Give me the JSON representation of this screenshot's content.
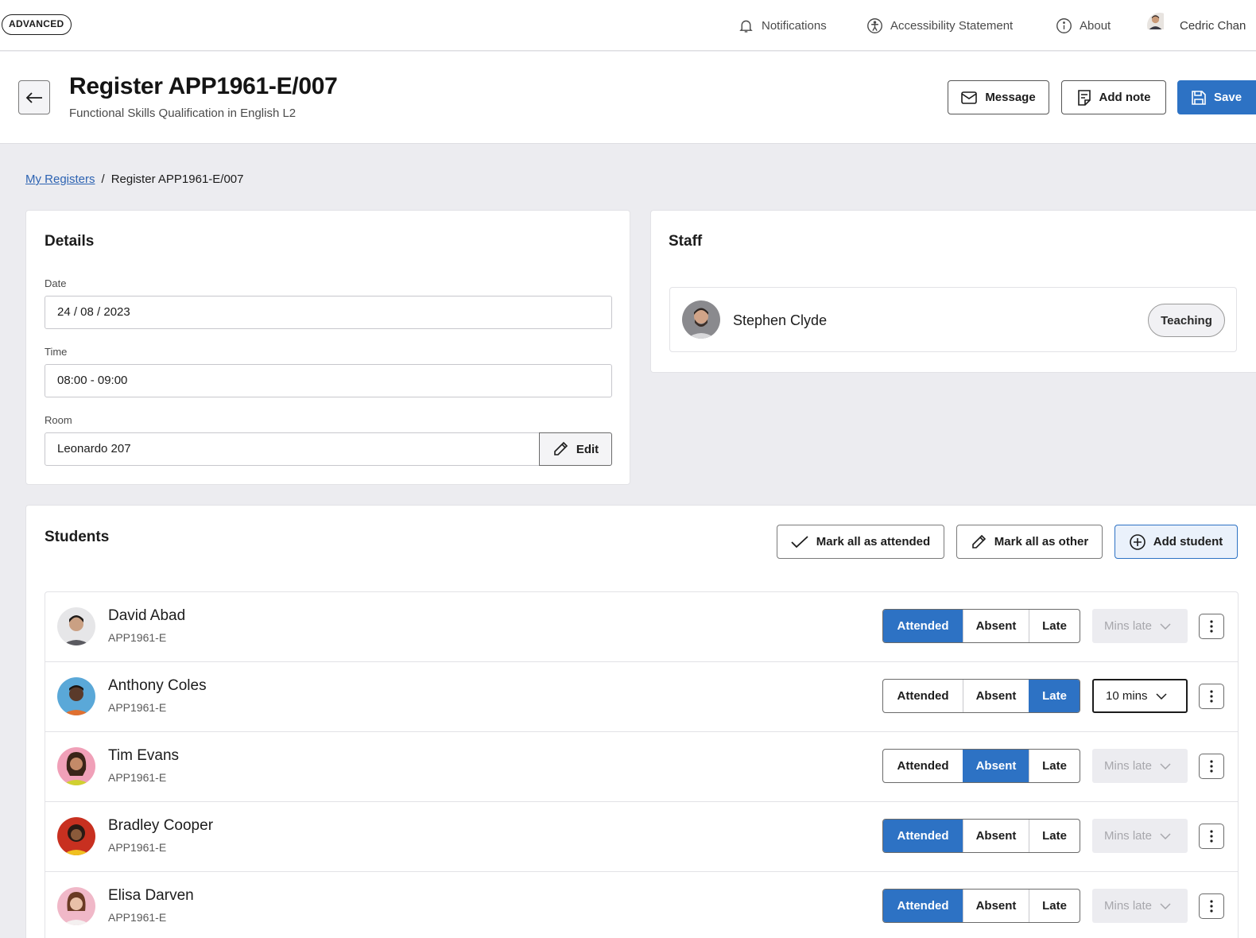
{
  "topbar": {
    "mode_badge": "ADVANCED",
    "nav": [
      {
        "label": "Notifications",
        "icon": "bell-icon"
      },
      {
        "label": "Accessibility Statement",
        "icon": "accessibility-icon"
      },
      {
        "label": "About",
        "icon": "info-icon"
      }
    ],
    "user_name": "Cedric Chan"
  },
  "header": {
    "title": "Register APP1961-E/007",
    "subtitle": "Functional Skills Qualification in English L2",
    "message_label": "Message",
    "add_note_label": "Add note",
    "save_label": "Save"
  },
  "breadcrumb": {
    "parent": "My Registers",
    "separator": "/",
    "current": "Register APP1961-E/007"
  },
  "details": {
    "title": "Details",
    "date_label": "Date",
    "date_value": "24 / 08 / 2023",
    "time_label": "Time",
    "time_value": "08:00 - 09:00",
    "room_label": "Room",
    "room_value": "Leonardo 207",
    "edit_label": "Edit"
  },
  "staff": {
    "title": "Staff",
    "members": [
      {
        "name": "Stephen Clyde",
        "role": "Teaching"
      }
    ]
  },
  "students": {
    "title": "Students",
    "mark_attended_label": "Mark all as attended",
    "mark_other_label": "Mark all as other",
    "add_student_label": "Add student",
    "options": {
      "attended": "Attended",
      "absent": "Absent",
      "late": "Late"
    },
    "mins_placeholder": "Mins late",
    "list": [
      {
        "name": "David Abad",
        "id": "APP1961-E",
        "status": "attended",
        "mins": "Mins late"
      },
      {
        "name": "Anthony Coles",
        "id": "APP1961-E",
        "status": "late",
        "mins": "10 mins"
      },
      {
        "name": "Tim Evans",
        "id": "APP1961-E",
        "status": "absent",
        "mins": "Mins late"
      },
      {
        "name": "Bradley Cooper",
        "id": "APP1961-E",
        "status": "attended",
        "mins": "Mins late"
      },
      {
        "name": "Elisa Darven",
        "id": "APP1961-E",
        "status": "attended",
        "mins": "Mins late"
      }
    ]
  },
  "colors": {
    "primary": "#2d72c4",
    "link": "#2d63b2",
    "page_bg": "#ececf0"
  }
}
